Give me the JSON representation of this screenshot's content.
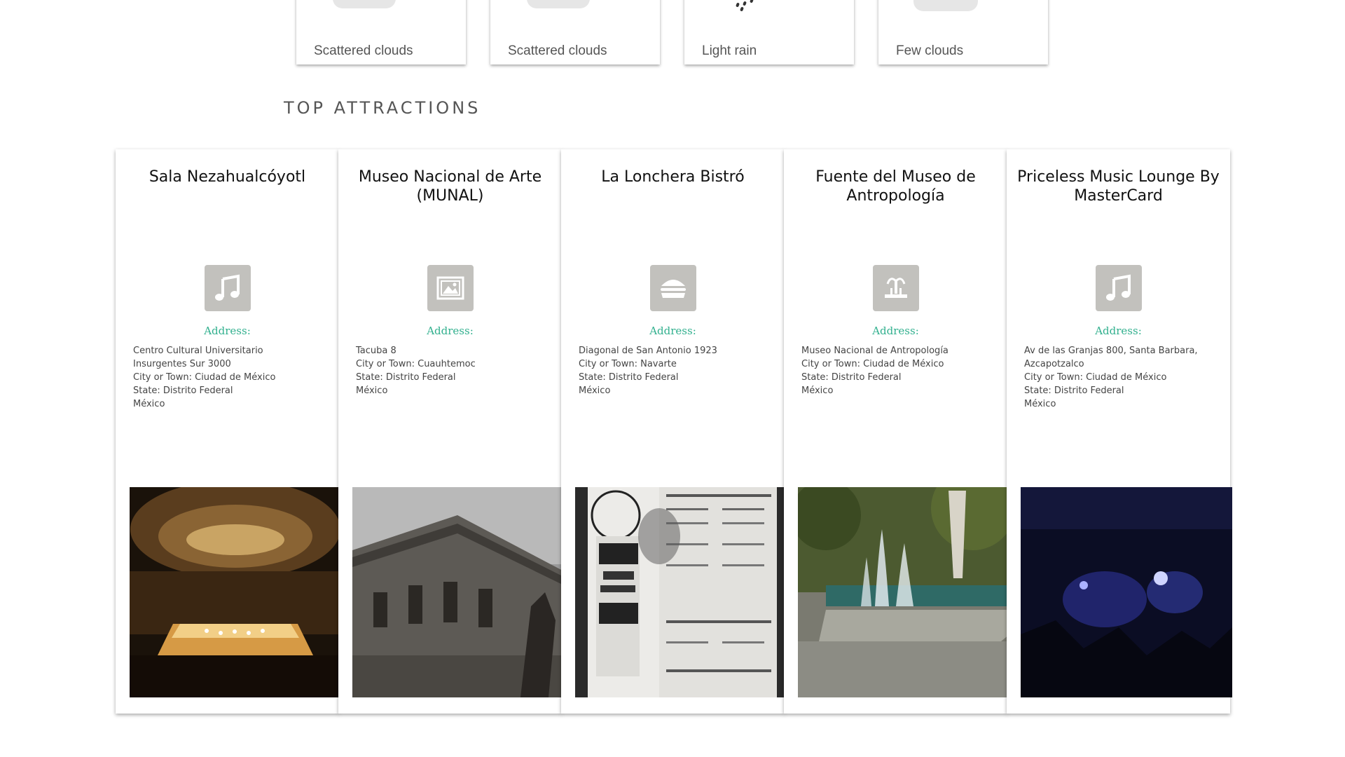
{
  "weather": {
    "items": [
      {
        "label": "Scattered clouds",
        "icon": "cloud-icon"
      },
      {
        "label": "Scattered clouds",
        "icon": "cloud-icon"
      },
      {
        "label": "Light rain",
        "icon": "rain-icon"
      },
      {
        "label": "Few clouds",
        "icon": "cloud-icon"
      }
    ]
  },
  "section": {
    "title": "TOP ATTRACTIONS"
  },
  "attractions": [
    {
      "name": "Sala Nezahualcóyotl",
      "category_icon": "music-note-icon",
      "address_label": "Address:",
      "address_lines": [
        "Centro Cultural Universitario",
        "Insurgentes Sur 3000",
        "City or Town: Ciudad de México",
        "State: Distrito Federal",
        "México"
      ]
    },
    {
      "name": "Museo Nacional de Arte (MUNAL)",
      "category_icon": "picture-icon",
      "address_label": "Address:",
      "address_lines": [
        "Tacuba 8",
        "City or Town: Cuauhtemoc",
        "State: Distrito Federal",
        "México"
      ]
    },
    {
      "name": "La Lonchera Bistró",
      "category_icon": "burger-icon",
      "address_label": "Address:",
      "address_lines": [
        "Diagonal de San Antonio 1923",
        "City or Town: Navarte",
        "State: Distrito Federal",
        "México"
      ]
    },
    {
      "name": "Fuente del Museo de Antropología",
      "category_icon": "fountain-icon",
      "address_label": "Address:",
      "address_lines": [
        "Museo Nacional de Antropología",
        "City or Town: Ciudad de México",
        "State: Distrito Federal",
        "México"
      ]
    },
    {
      "name": "Priceless Music Lounge By MasterCard",
      "category_icon": "music-note-icon",
      "address_label": "Address:",
      "address_lines": [
        "Av de las Granjas 800, Santa Barbara,",
        "Azcapotzalco",
        "City or Town: Ciudad de México",
        "State: Distrito Federal",
        "México"
      ]
    }
  ],
  "colors": {
    "address_label": "#31b08e",
    "icon_tile": "#c2c1bd"
  }
}
